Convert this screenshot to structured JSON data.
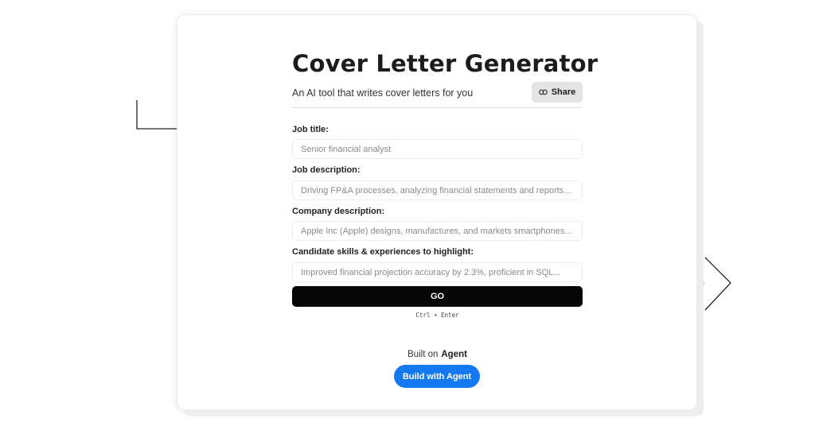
{
  "header": {
    "title": "Cover Letter Generator",
    "subtitle": "An AI tool that writes cover letters for you",
    "share_label": "Share",
    "share_icon": "link-icon"
  },
  "form": {
    "fields": [
      {
        "label": "Job title:",
        "value": "Senior financial analyst"
      },
      {
        "label": "Job description:",
        "value": "Driving FP&A processes, analyzing financial statements and reports..."
      },
      {
        "label": "Company description:",
        "value": "Apple Inc (Apple) designs, manufactures, and markets smartphones..."
      },
      {
        "label": "Candidate skills & experiences to highlight:",
        "value": "Improved financial projection accuracy by 2.3%, proficient in SQL..."
      }
    ],
    "submit_label": "GO",
    "shortcut_hint": "Ctrl + Enter"
  },
  "footer": {
    "built_on_prefix": "Built on",
    "built_on_brand": "Agent",
    "build_button_label": "Build with Agent"
  },
  "colors": {
    "go_button": "#050505",
    "build_button": "#1479f0",
    "share_button": "#e3e3e3"
  }
}
